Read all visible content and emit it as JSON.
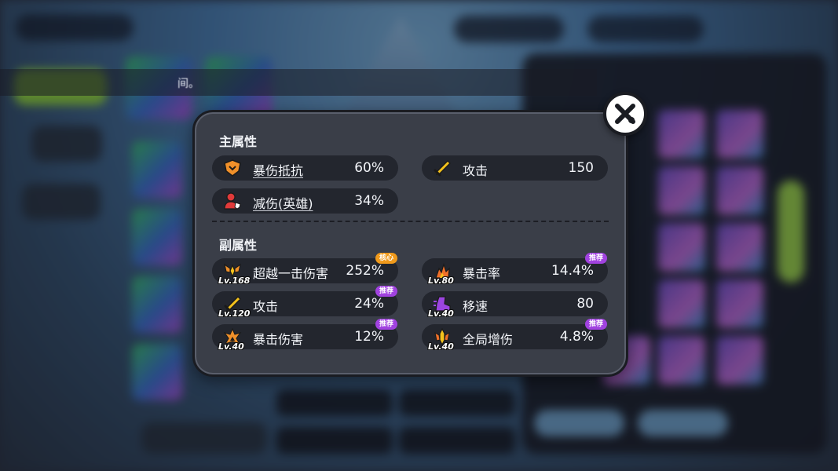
{
  "background": {
    "banner_text": "间。"
  },
  "popup": {
    "main_title": "主属性",
    "sub_title": "副属性",
    "main_stats": [
      {
        "name": "暴伤抵抗",
        "value": "60%",
        "icon": "shield-icon",
        "color": "#f0902a"
      },
      {
        "name": "攻击",
        "value": "150",
        "icon": "sword-icon",
        "color": "#f4c21c"
      },
      {
        "name": "减伤(英雄)",
        "value": "34%",
        "icon": "hero-defense-icon",
        "color": "#e03a3a"
      }
    ],
    "sub_stats": [
      {
        "name": "超越一击伤害",
        "value": "252%",
        "level": "Lv.168",
        "badge": "核心",
        "icon": "winged-emblem-icon"
      },
      {
        "name": "暴击率",
        "value": "14.4%",
        "level": "Lv.80",
        "badge": "推荐",
        "icon": "critical-rate-icon"
      },
      {
        "name": "攻击",
        "value": "24%",
        "level": "Lv.120",
        "badge": "推荐",
        "icon": "sword-icon"
      },
      {
        "name": "移速",
        "value": "80",
        "level": "Lv.40",
        "badge": "",
        "icon": "boot-icon"
      },
      {
        "name": "暴击伤害",
        "value": "12%",
        "level": "Lv.40",
        "badge": "推荐",
        "icon": "critical-damage-icon"
      },
      {
        "name": "全局增伤",
        "value": "4.8%",
        "level": "Lv.40",
        "badge": "推荐",
        "icon": "global-damage-icon"
      }
    ],
    "badge_colors": {
      "推荐": "#a142e0",
      "核心": "#f09a1c"
    }
  }
}
